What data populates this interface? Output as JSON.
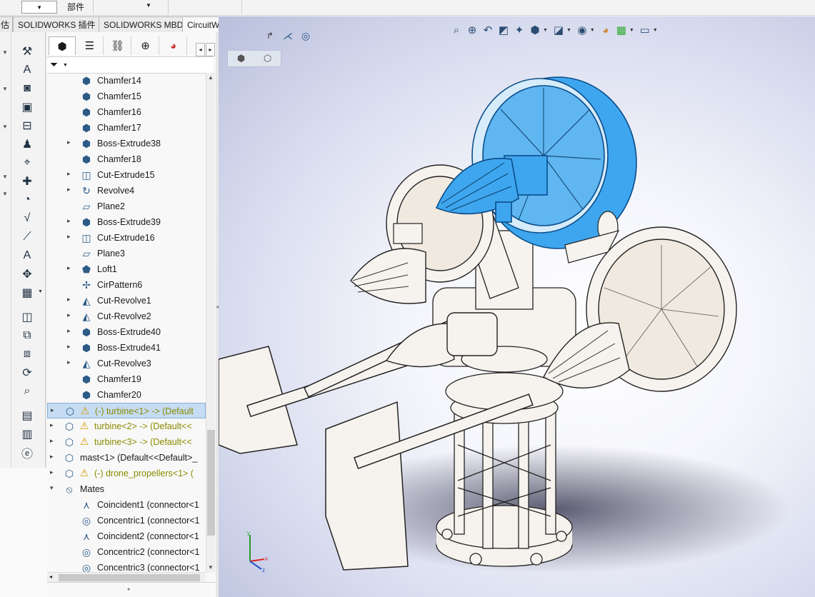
{
  "top_toolbar": {
    "part_label": "部件"
  },
  "command_tabs": [
    {
      "label": "估",
      "active": false
    },
    {
      "label": "SOLIDWORKS 插件",
      "active": false
    },
    {
      "label": "SOLIDWORKS MBD",
      "active": false
    },
    {
      "label": "CircuitWorks",
      "active": true
    }
  ],
  "command_icons": [
    "measure-icon",
    "annotation-icon",
    "camera-xxx-icon",
    "camera-box-icon",
    "dimension-icon",
    "chain-icon",
    "assembly-icon",
    "plus-icon",
    "gauge-a1-icon",
    "check-icon",
    "sketch-icon",
    "text-a-icon",
    "move-icon",
    "table-icon",
    "3d-view-icon",
    "model-break-icon",
    "layout-icon",
    "rotate-icon",
    "zoom-icon",
    "pdf-icon",
    "3d-pdf-icon",
    "edrawings-icon"
  ],
  "feature_manager": {
    "tabs": [
      "feature-tree-tab",
      "property-tab",
      "config-tab",
      "dimxpert-tab",
      "display-tab"
    ],
    "tree": [
      {
        "label": "Chamfer14",
        "icon": "chamfer-icon",
        "expandable": false,
        "indent": 1
      },
      {
        "label": "Chamfer15",
        "icon": "chamfer-icon",
        "expandable": false,
        "indent": 1
      },
      {
        "label": "Chamfer16",
        "icon": "chamfer-icon",
        "expandable": false,
        "indent": 1
      },
      {
        "label": "Chamfer17",
        "icon": "chamfer-icon",
        "expandable": false,
        "indent": 1
      },
      {
        "label": "Boss-Extrude38",
        "icon": "boss-extrude-icon",
        "expandable": true,
        "indent": 1
      },
      {
        "label": "Chamfer18",
        "icon": "chamfer-icon",
        "expandable": false,
        "indent": 1
      },
      {
        "label": "Cut-Extrude15",
        "icon": "cut-extrude-icon",
        "expandable": true,
        "indent": 1
      },
      {
        "label": "Revolve4",
        "icon": "revolve-icon",
        "expandable": true,
        "indent": 1
      },
      {
        "label": "Plane2",
        "icon": "plane-icon",
        "expandable": false,
        "indent": 1
      },
      {
        "label": "Boss-Extrude39",
        "icon": "boss-extrude-icon",
        "expandable": true,
        "indent": 1
      },
      {
        "label": "Cut-Extrude16",
        "icon": "cut-extrude-icon",
        "expandable": true,
        "indent": 1
      },
      {
        "label": "Plane3",
        "icon": "plane-icon",
        "expandable": false,
        "indent": 1
      },
      {
        "label": "Loft1",
        "icon": "loft-icon",
        "expandable": true,
        "indent": 1
      },
      {
        "label": "CirPattern6",
        "icon": "circular-pattern-icon",
        "expandable": false,
        "indent": 1
      },
      {
        "label": "Cut-Revolve1",
        "icon": "cut-revolve-icon",
        "expandable": true,
        "indent": 1
      },
      {
        "label": "Cut-Revolve2",
        "icon": "cut-revolve-icon",
        "expandable": true,
        "indent": 1
      },
      {
        "label": "Boss-Extrude40",
        "icon": "boss-extrude-icon",
        "expandable": true,
        "indent": 1
      },
      {
        "label": "Boss-Extrude41",
        "icon": "boss-extrude-icon",
        "expandable": true,
        "indent": 1
      },
      {
        "label": "Cut-Revolve3",
        "icon": "cut-revolve-icon",
        "expandable": true,
        "indent": 1
      },
      {
        "label": "Chamfer19",
        "icon": "chamfer-icon",
        "expandable": false,
        "indent": 1
      },
      {
        "label": "Chamfer20",
        "icon": "chamfer-icon",
        "expandable": false,
        "indent": 1
      },
      {
        "label": "(-) turbine<1> -> (Default",
        "icon": "part-icon",
        "expandable": true,
        "indent": 0,
        "warning": true,
        "selected": true
      },
      {
        "label": "turbine<2> -> (Default<<",
        "icon": "part-icon",
        "expandable": true,
        "indent": 0,
        "warning": true
      },
      {
        "label": "turbine<3> -> (Default<<",
        "icon": "part-icon",
        "expandable": true,
        "indent": 0,
        "warning": true
      },
      {
        "label": "mast<1> (Default<<Default>_",
        "icon": "part-icon",
        "expandable": true,
        "indent": 0
      },
      {
        "label": "(-) drone_propellers<1> (",
        "icon": "part-icon",
        "expandable": true,
        "indent": 0,
        "warning": true
      },
      {
        "label": "Mates",
        "icon": "mates-icon",
        "expandable": true,
        "expanded": true,
        "indent": 0
      },
      {
        "label": "Coincident1 (connector<1",
        "icon": "coincident-icon",
        "expandable": false,
        "indent": 1
      },
      {
        "label": "Concentric1 (connector<1",
        "icon": "concentric-icon",
        "expandable": false,
        "indent": 1
      },
      {
        "label": "Coincident2 (connector<1",
        "icon": "coincident-icon",
        "expandable": false,
        "indent": 1
      },
      {
        "label": "Concentric2 (connector<1",
        "icon": "concentric-icon",
        "expandable": false,
        "indent": 1
      },
      {
        "label": "Concentric3 (connector<1",
        "icon": "concentric-icon",
        "expandable": false,
        "indent": 1
      }
    ]
  },
  "heads_up_toolbar": [
    "zoom-to-fit-icon",
    "zoom-area-icon",
    "previous-view-icon",
    "section-view-icon",
    "dynamic-annotation-icon",
    "view-orientation-icon",
    "display-style-icon",
    "hide-show-icon",
    "edit-appearance-icon",
    "apply-scene-icon",
    "view-settings-icon"
  ],
  "colors": {
    "selected_part": "#3ea6ee",
    "viewport_center": "#ffffff",
    "viewport_edge": "#b9bfdc",
    "warning": "#d59a00"
  }
}
